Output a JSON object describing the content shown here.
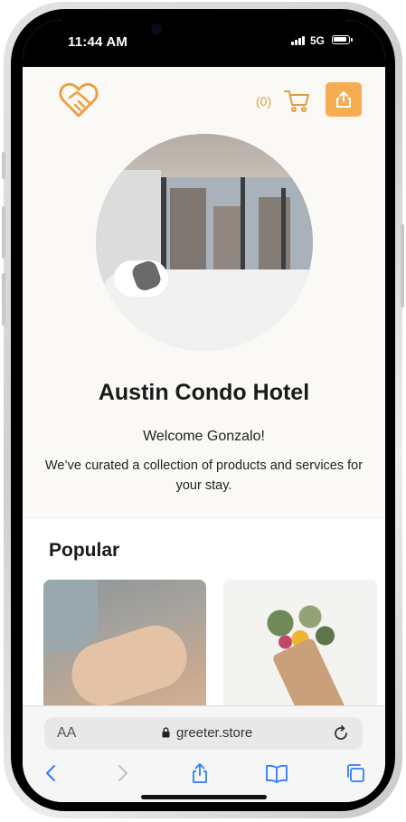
{
  "status_bar": {
    "time": "11:44 AM",
    "network": "5G"
  },
  "header": {
    "logo_icon": "heart-handshake-logo",
    "cart_count": "(0)",
    "cart_icon": "cart-icon",
    "share_icon": "share-icon"
  },
  "hero": {
    "hotel_name": "Austin Condo Hotel",
    "welcome": "Welcome Gonzalo!",
    "tagline": "We’ve curated a collection of products and services for your stay."
  },
  "popular": {
    "title": "Popular",
    "cards": [
      {
        "image": "massage-photo"
      },
      {
        "image": "flower-bouquet-photo"
      }
    ]
  },
  "browser": {
    "aa_label": "AA",
    "url": "greeter.store"
  },
  "colors": {
    "accent": "#f6ad52",
    "accent_text": "#e09c3c",
    "ios_blue": "#2f7cf6"
  }
}
